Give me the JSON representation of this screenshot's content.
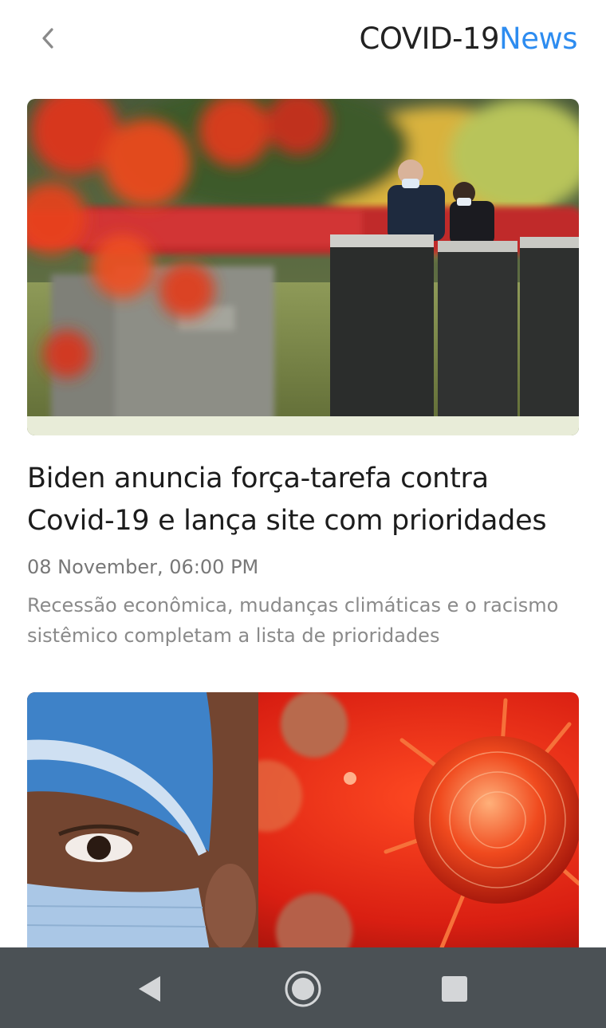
{
  "header": {
    "brand_part1": "COVID-19",
    "brand_part2": "News",
    "back_icon": "chevron-left-icon"
  },
  "articles": [
    {
      "title": "Biden anuncia força-tarefa contra Covid-19 e lança site com prioridades",
      "date": "08 November, 06:00 PM",
      "description": "Recessão econômica, mudanças climáticas e o racismo sistêmico completam a lista de prioridades"
    },
    {}
  ],
  "navigation": {
    "back_icon": "triangle-back-icon",
    "home_icon": "circle-home-icon",
    "recents_icon": "square-recents-icon"
  },
  "colors": {
    "brand_accent": "#2d8cf0",
    "nav_bar": "#4b5155"
  }
}
